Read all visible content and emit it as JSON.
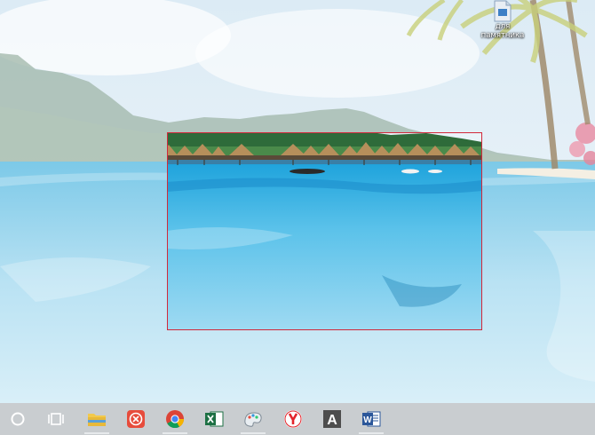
{
  "desktop": {
    "icon_label_line1": "для",
    "icon_label_line2": "памятника"
  },
  "snip": {
    "frame_color": "#d2283a"
  },
  "taskbar": {
    "items": [
      {
        "name": "cortana-search",
        "icon": "circle-icon"
      },
      {
        "name": "task-view",
        "icon": "task-view-icon"
      },
      {
        "name": "file-explorer",
        "icon": "folder-icon"
      },
      {
        "name": "app-red-circle",
        "icon": "red-x-circle-icon"
      },
      {
        "name": "chrome",
        "icon": "chrome-icon"
      },
      {
        "name": "excel",
        "icon": "excel-icon"
      },
      {
        "name": "app-paint",
        "icon": "paint-icon"
      },
      {
        "name": "yandex-browser",
        "icon": "yandex-icon"
      },
      {
        "name": "font-app",
        "icon": "letter-a-icon",
        "glyph": "A"
      },
      {
        "name": "word",
        "icon": "word-icon",
        "glyph": "W"
      }
    ]
  }
}
